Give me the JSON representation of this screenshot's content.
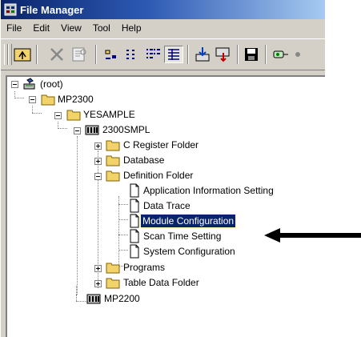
{
  "window": {
    "title": "File Manager"
  },
  "menu": [
    "File",
    "Edit",
    "View",
    "Tool",
    "Help"
  ],
  "toolbar": {
    "buttons": [
      "folder-up-icon",
      "cut-icon",
      "properties-icon",
      "large-icons-icon",
      "small-icons-icon",
      "list-view-icon",
      "details-view-icon",
      "import-icon",
      "export-icon",
      "save-icon",
      "link-icon"
    ]
  },
  "tree": {
    "root": "(root)",
    "mp2300": "MP2300",
    "yesample": "YESAMPLE",
    "smpl": "2300SMPL",
    "c_register": "C Register Folder",
    "database": "Database",
    "definition": "Definition Folder",
    "app_info": "Application Information Setting",
    "data_trace": "Data Trace",
    "module_config": "Module Configuration",
    "scan_time": "Scan Time Setting",
    "system_config": "System Configuration",
    "programs": "Programs",
    "table_data": "Table Data Folder",
    "mp2200": "MP2200"
  },
  "selected": "Module Configuration",
  "colors": {
    "selection": "#0a246a",
    "folder": "#f2d36b",
    "title_start": "#0a246a",
    "title_end": "#a6caf0"
  }
}
